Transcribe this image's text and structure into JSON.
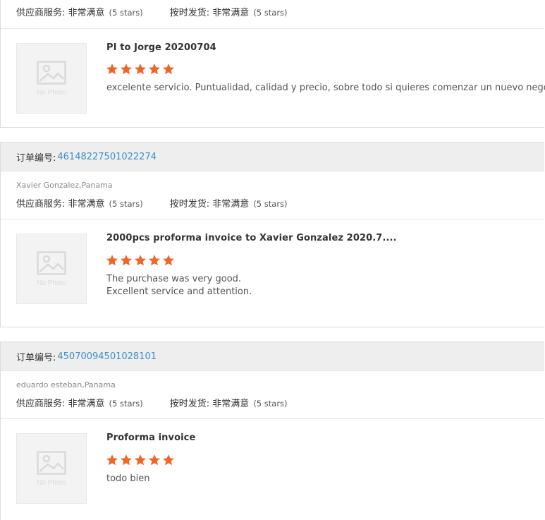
{
  "labels": {
    "order_prefix": "订单编号:",
    "supplier_service": "供应商服务:",
    "shipping_speed": "按时发货:",
    "very_satisfied": "非常满意",
    "five_stars": "(5 stars)",
    "no_photo": "No Photo"
  },
  "colors": {
    "star": "#f0652a",
    "link": "#3a8fc7",
    "header_bg": "#eeeeee"
  },
  "reviews": [
    {
      "order_number": "",
      "buyer": "",
      "supplier_rating": 5,
      "shipping_rating": 5,
      "title": "PI to Jorge 20200704",
      "stars": 5,
      "comment_lines": [
        "excelente servicio. Puntualidad, calidad y precio, sobre todo si quieres comenzar un nuevo negocio"
      ]
    },
    {
      "order_number": "46148227501022274",
      "buyer": "Xavier Gonzalez,Panama",
      "supplier_rating": 5,
      "shipping_rating": 5,
      "title": "2000pcs proforma invoice to Xavier Gonzalez 2020.7....",
      "stars": 5,
      "comment_lines": [
        "The purchase was very good.",
        "Excellent service and attention."
      ]
    },
    {
      "order_number": "45070094501028101",
      "buyer": "eduardo esteban,Panama",
      "supplier_rating": 5,
      "shipping_rating": 5,
      "title": "Proforma invoice",
      "stars": 5,
      "comment_lines": [
        "todo bien"
      ]
    }
  ]
}
